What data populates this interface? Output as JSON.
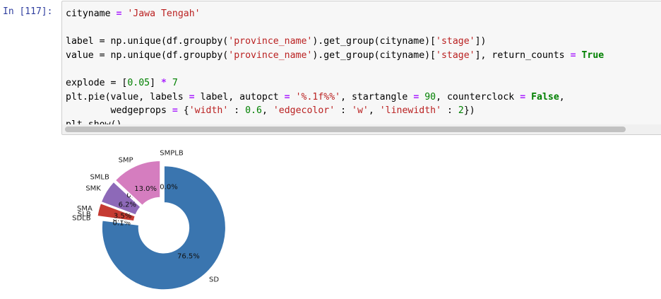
{
  "cell": {
    "prompt": "In [117]:",
    "code": {
      "line1": {
        "var": "cityname",
        "eq": " = ",
        "str": "'Jawa Tengah'"
      },
      "line2": {
        "a": "label = np.unique(df.groupby(",
        "s1": "'province_name'",
        "b": ").get_group(cityname)[",
        "s2": "'stage'",
        "c": "])"
      },
      "line3": {
        "a": "value = np.unique(df.groupby(",
        "s1": "'province_name'",
        "b": ").get_group(cityname)[",
        "s2": "'stage'",
        "c": "], return_counts ",
        "eq": "=",
        "kw": " True"
      },
      "line4": {
        "a": "explode = [",
        "num": "0.05",
        "b": "] ",
        "op": "*",
        "num2": " 7"
      },
      "line5": {
        "a": "plt.pie(value, labels ",
        "eq": "=",
        "b": " label, autopct ",
        "eq2": "=",
        "s": " '%.1f%%'",
        "c": ", startangle ",
        "eq3": "=",
        "num": " 90",
        "d": ", counterclock ",
        "eq4": "=",
        "kw": " False",
        "e": ","
      },
      "line6": {
        "a": "        wedgeprops ",
        "eq": "=",
        "b": " {",
        "s1": "'width'",
        "c": " : ",
        "num1": "0.6",
        "d": ", ",
        "s2": "'edgecolor'",
        "e": " : ",
        "s3": "'w'",
        "f": ", ",
        "s4": "'linewidth'",
        "g": " : ",
        "num2": "2",
        "h": "})"
      },
      "line7": {
        "a": "plt.show()"
      }
    }
  },
  "chart_data": {
    "type": "pie",
    "donut_width_fraction": 0.6,
    "startangle": 90,
    "counterclock": false,
    "explode": 0.05,
    "labels": [
      "SD",
      "SDLB",
      "SLB",
      "SMA",
      "SMK",
      "SMLB",
      "SMP",
      "SMPLB"
    ],
    "values": [
      76.5,
      0.1,
      0.1,
      3.5,
      6.2,
      0.0,
      13.0,
      0.0
    ],
    "pct_labels": [
      "76.5%",
      "0.1%",
      "0.1%",
      "3.5%",
      "6.2%",
      "0.0%",
      "13.0%",
      "0.0%"
    ],
    "colors": [
      "#3a75af",
      "#ef8636",
      "#519e3e",
      "#c53a32",
      "#8d69b8",
      "#84584e",
      "#d57dbf",
      "#7f7f7f"
    ]
  }
}
